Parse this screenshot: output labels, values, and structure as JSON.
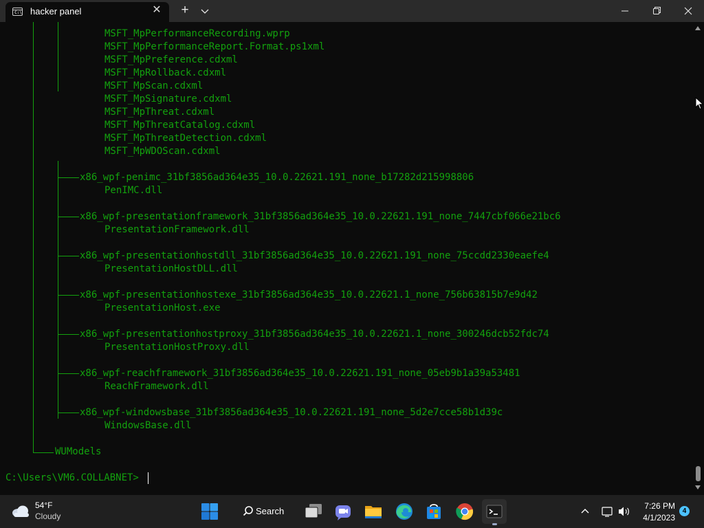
{
  "window": {
    "tab_title": "hacker panel",
    "tab_close_glyph": "✕",
    "new_tab_glyph": "+",
    "tab_icon_text": "C:\\"
  },
  "terminal": {
    "file_lines": [
      "MSFT_MpPerformanceRecording.wprp",
      "MSFT_MpPerformanceReport.Format.ps1xml",
      "MSFT_MpPreference.cdxml",
      "MSFT_MpRollback.cdxml",
      "MSFT_MpScan.cdxml",
      "MSFT_MpSignature.cdxml",
      "MSFT_MpThreat.cdxml",
      "MSFT_MpThreatCatalog.cdxml",
      "MSFT_MpThreatDetection.cdxml",
      "MSFT_MpWDOScan.cdxml"
    ],
    "packages": [
      {
        "dir": "x86_wpf-penimc_31bf3856ad364e35_10.0.22621.191_none_b17282d215998806",
        "file": "PenIMC.dll"
      },
      {
        "dir": "x86_wpf-presentationframework_31bf3856ad364e35_10.0.22621.191_none_7447cbf066e21bc6",
        "file": "PresentationFramework.dll"
      },
      {
        "dir": "x86_wpf-presentationhostdll_31bf3856ad364e35_10.0.22621.191_none_75ccdd2330eaefe4",
        "file": "PresentationHostDLL.dll"
      },
      {
        "dir": "x86_wpf-presentationhostexe_31bf3856ad364e35_10.0.22621.1_none_756b63815b7e9d42",
        "file": "PresentationHost.exe"
      },
      {
        "dir": "x86_wpf-presentationhostproxy_31bf3856ad364e35_10.0.22621.1_none_300246dcb52fdc74",
        "file": "PresentationHostProxy.dll"
      },
      {
        "dir": "x86_wpf-reachframework_31bf3856ad364e35_10.0.22621.191_none_05eb9b1a39a53481",
        "file": "ReachFramework.dll"
      },
      {
        "dir": "x86_wpf-windowsbase_31bf3856ad364e35_10.0.22621.191_none_5d2e7cce58b1d39c",
        "file": "WindowsBase.dll"
      }
    ],
    "last_folder": "WUModels",
    "prompt": "C:\\Users\\VM6.COLLABNET>",
    "text_color": "#13a10e"
  },
  "taskbar": {
    "weather": {
      "temperature": "54°F",
      "condition": "Cloudy"
    },
    "search_label": "Search",
    "apps": [
      {
        "name": "start",
        "icon": "windows-logo-icon"
      },
      {
        "name": "search",
        "icon": "search-icon"
      },
      {
        "name": "task-view",
        "icon": "task-view-icon"
      },
      {
        "name": "chat",
        "icon": "teams-chat-icon"
      },
      {
        "name": "file-explorer",
        "icon": "folder-icon"
      },
      {
        "name": "edge",
        "icon": "edge-icon"
      },
      {
        "name": "store",
        "icon": "store-icon"
      },
      {
        "name": "chrome",
        "icon": "chrome-icon"
      },
      {
        "name": "terminal",
        "icon": "terminal-icon"
      }
    ],
    "clock": {
      "time": "7:26 PM",
      "date": "4/1/2023"
    },
    "notification_count": "4"
  }
}
